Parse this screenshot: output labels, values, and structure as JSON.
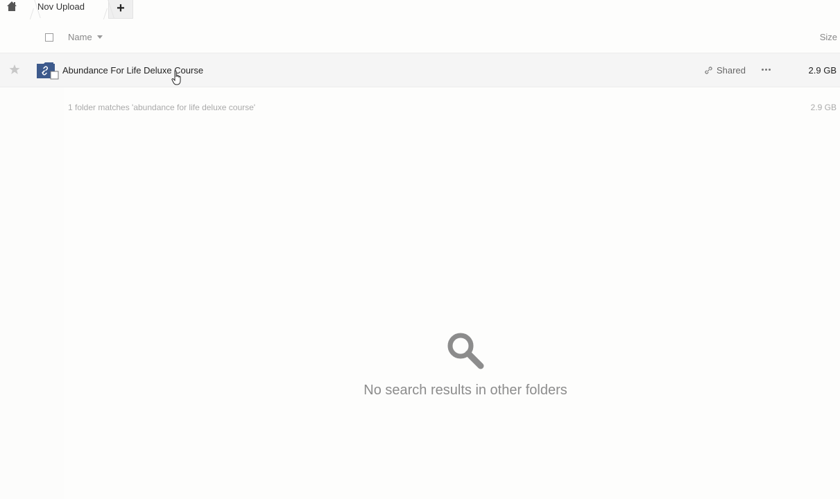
{
  "breadcrumb": {
    "home_icon": "home-icon",
    "current_folder": "Nov Upload",
    "add_label": "+"
  },
  "list_header": {
    "name_label": "Name",
    "size_label": "Size"
  },
  "files": [
    {
      "name": "Abundance For Life Deluxe Course",
      "type_icon": "shared-folder-icon",
      "share_status": "Shared",
      "size": "2.9 GB",
      "starred": false
    }
  ],
  "summary": {
    "text": "1 folder matches 'abundance for life deluxe course'",
    "total_size": "2.9 GB"
  },
  "empty_state": {
    "icon": "search-icon",
    "message": "No search results in other folders"
  },
  "colors": {
    "folder": "#3d5a8c",
    "row_hover": "#f5f5f5",
    "muted_text": "#8c8c8c"
  }
}
